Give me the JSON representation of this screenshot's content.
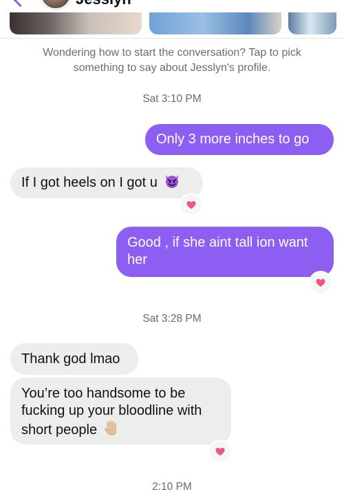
{
  "header": {
    "contact_name": "Jesslyn",
    "back_icon": "chevron-left-icon",
    "accent": "#8a63e6"
  },
  "hint": {
    "text": "Wondering how to start the conversation? Tap to pick something to say about Jesslyn's profile."
  },
  "timestamps": [
    "Sat 3:10 PM",
    "Sat 3:28 PM",
    "2:10 PM"
  ],
  "messages": [
    {
      "from": "me",
      "text": "Only 3 more inches to go"
    },
    {
      "from": "them",
      "text": "If I got heels on I got u",
      "emoji": "smiling-devil-emoji",
      "reaction": "heart"
    },
    {
      "from": "me",
      "text": "Good , if she aint tall ion want her",
      "reaction": "heart"
    },
    {
      "from": "them",
      "text": "Thank god lmao"
    },
    {
      "from": "them",
      "text": "You’re too handsome to be fucking up your bloodline with short people",
      "emoji": "raised-hand-emoji",
      "reaction": "heart"
    }
  ],
  "colors": {
    "outgoing_bubble": "#8c5ef2",
    "incoming_bubble": "#ededed",
    "reaction_heart": "#f0577e"
  }
}
